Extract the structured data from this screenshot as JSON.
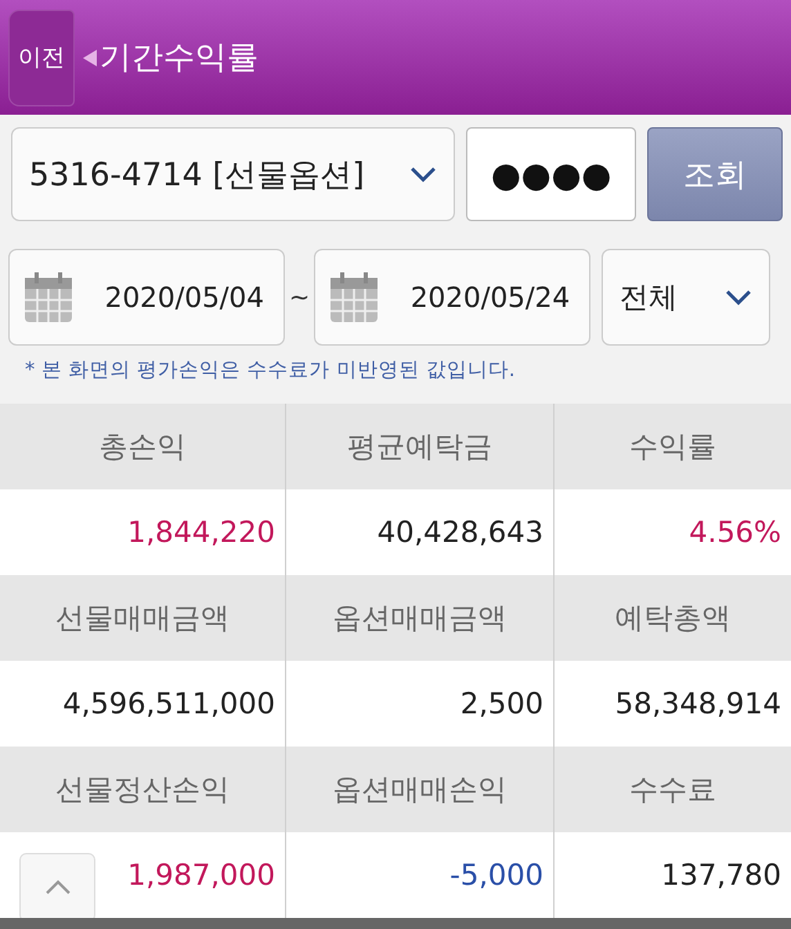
{
  "header": {
    "back": "이전",
    "title": "기간수익률"
  },
  "account": {
    "value": "5316-4714 [선물옵션]"
  },
  "password": {
    "value": "●●●●"
  },
  "query_button": "조회",
  "date_from": "2020/05/04",
  "separator": "~",
  "date_to": "2020/05/24",
  "filter": {
    "value": "전체"
  },
  "note": "* 본 화면의 평가손익은 수수료가 미반영된 값입니다.",
  "table": {
    "rows": [
      {
        "kind": "head",
        "cells": [
          {
            "text": "총손익"
          },
          {
            "text": "평균예탁금"
          },
          {
            "text": "수익률"
          }
        ]
      },
      {
        "kind": "value",
        "cells": [
          {
            "text": "1,844,220",
            "color": "#c2185b"
          },
          {
            "text": "40,428,643",
            "color": "#222222"
          },
          {
            "text": "4.56%",
            "color": "#c2185b"
          }
        ]
      },
      {
        "kind": "head",
        "cells": [
          {
            "text": "선물매매금액"
          },
          {
            "text": "옵션매매금액"
          },
          {
            "text": "예탁총액"
          }
        ]
      },
      {
        "kind": "value",
        "cells": [
          {
            "text": "4,596,511,000",
            "color": "#222222"
          },
          {
            "text": "2,500",
            "color": "#222222"
          },
          {
            "text": "58,348,914",
            "color": "#222222"
          }
        ]
      },
      {
        "kind": "head",
        "cells": [
          {
            "text": "선물정산손익"
          },
          {
            "text": "옵션매매손익"
          },
          {
            "text": "수수료"
          }
        ]
      },
      {
        "kind": "value",
        "cells": [
          {
            "text": "1,987,000",
            "color": "#c2185b"
          },
          {
            "text": "-5,000",
            "color": "#2a4fa8"
          },
          {
            "text": "137,780",
            "color": "#222222"
          }
        ]
      }
    ]
  }
}
